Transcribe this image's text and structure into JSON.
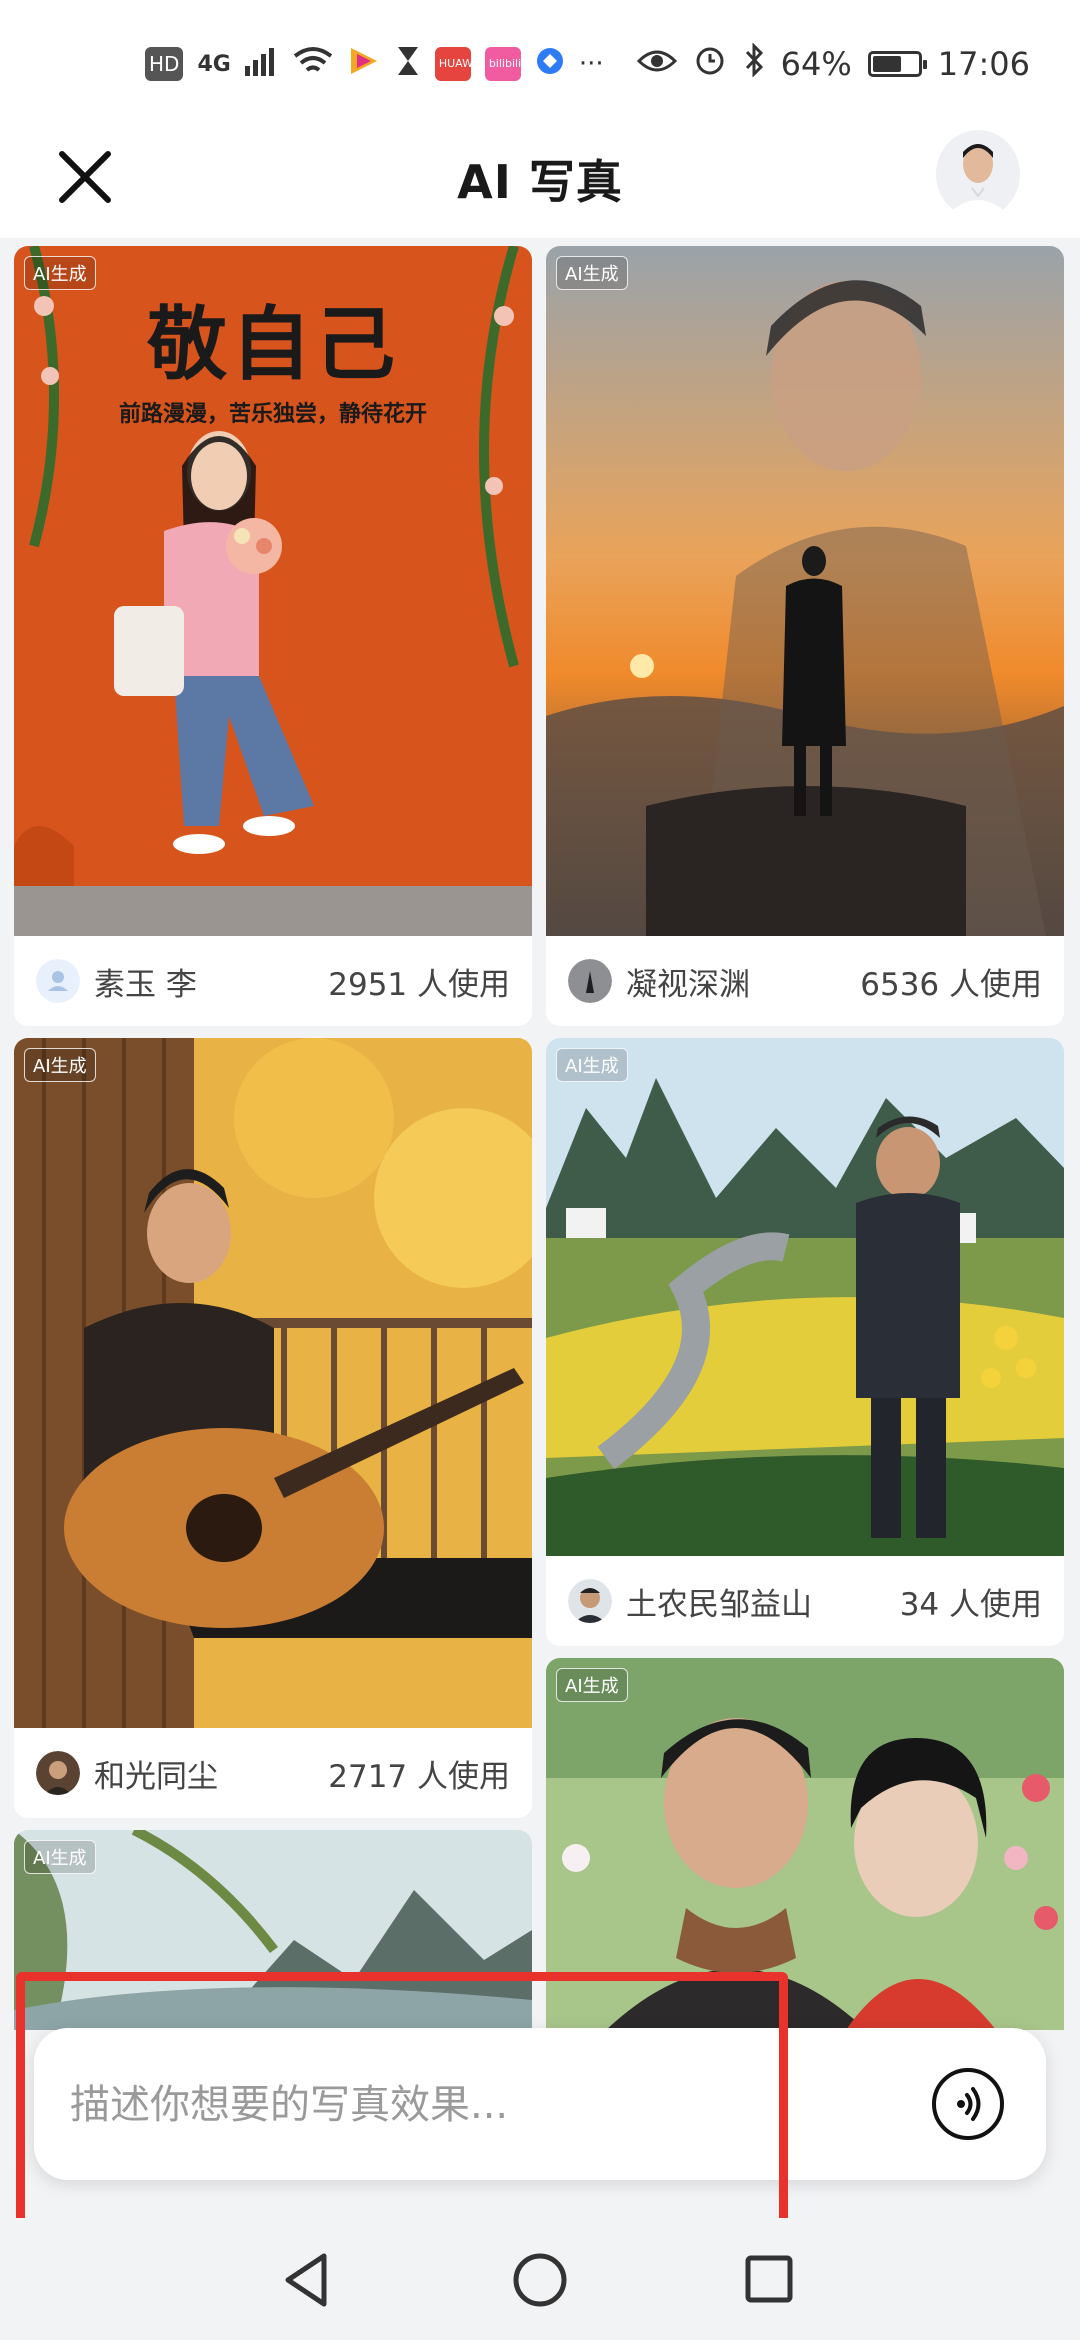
{
  "status_bar": {
    "left_icons": [
      "HD",
      "4G",
      "signal-icon",
      "wifi-icon",
      "app-icon",
      "hourglass-icon",
      "HUAWEI",
      "bilibili",
      "app-icon",
      "…"
    ],
    "hd_label": "HD",
    "network_label": "4G",
    "huawei_label": "HUAWEI",
    "bili_label": "bilibili",
    "more_label": "···",
    "battery_percent": "64%",
    "battery_level": 0.64,
    "time": "17:06"
  },
  "header": {
    "title": "AI 写真"
  },
  "cards": [
    {
      "ai_tag": "AI生成",
      "poster_title": "敬自己",
      "poster_subtitle": "前路漫漫，苦乐独尝，静待花开",
      "user": "素玉 李",
      "count": "2951 人使用"
    },
    {
      "ai_tag": "AI生成",
      "user": "凝视深渊",
      "count": "6536 人使用"
    },
    {
      "ai_tag": "AI生成",
      "user": "和光同尘",
      "count": "2717 人使用"
    },
    {
      "ai_tag": "AI生成",
      "user": "土农民邹益山",
      "count": "34 人使用"
    },
    {
      "ai_tag": "AI生成"
    },
    {
      "ai_tag": "AI生成"
    }
  ],
  "input": {
    "placeholder": "描述你想要的写真效果..."
  },
  "colors": {
    "accent_red": "#e8322b",
    "background": "#f2f3f5"
  }
}
